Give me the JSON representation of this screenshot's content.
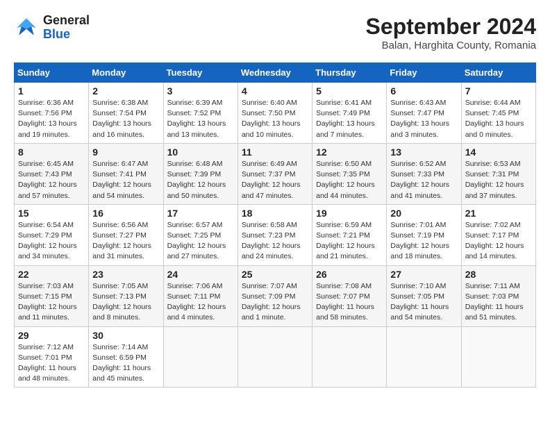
{
  "header": {
    "logo_line1": "General",
    "logo_line2": "Blue",
    "month": "September 2024",
    "location": "Balan, Harghita County, Romania"
  },
  "weekdays": [
    "Sunday",
    "Monday",
    "Tuesday",
    "Wednesday",
    "Thursday",
    "Friday",
    "Saturday"
  ],
  "weeks": [
    [
      {
        "day": "1",
        "sunrise": "6:36 AM",
        "sunset": "7:56 PM",
        "daylight": "13 hours and 19 minutes."
      },
      {
        "day": "2",
        "sunrise": "6:38 AM",
        "sunset": "7:54 PM",
        "daylight": "13 hours and 16 minutes."
      },
      {
        "day": "3",
        "sunrise": "6:39 AM",
        "sunset": "7:52 PM",
        "daylight": "13 hours and 13 minutes."
      },
      {
        "day": "4",
        "sunrise": "6:40 AM",
        "sunset": "7:50 PM",
        "daylight": "13 hours and 10 minutes."
      },
      {
        "day": "5",
        "sunrise": "6:41 AM",
        "sunset": "7:49 PM",
        "daylight": "13 hours and 7 minutes."
      },
      {
        "day": "6",
        "sunrise": "6:43 AM",
        "sunset": "7:47 PM",
        "daylight": "13 hours and 3 minutes."
      },
      {
        "day": "7",
        "sunrise": "6:44 AM",
        "sunset": "7:45 PM",
        "daylight": "13 hours and 0 minutes."
      }
    ],
    [
      {
        "day": "8",
        "sunrise": "6:45 AM",
        "sunset": "7:43 PM",
        "daylight": "12 hours and 57 minutes."
      },
      {
        "day": "9",
        "sunrise": "6:47 AM",
        "sunset": "7:41 PM",
        "daylight": "12 hours and 54 minutes."
      },
      {
        "day": "10",
        "sunrise": "6:48 AM",
        "sunset": "7:39 PM",
        "daylight": "12 hours and 50 minutes."
      },
      {
        "day": "11",
        "sunrise": "6:49 AM",
        "sunset": "7:37 PM",
        "daylight": "12 hours and 47 minutes."
      },
      {
        "day": "12",
        "sunrise": "6:50 AM",
        "sunset": "7:35 PM",
        "daylight": "12 hours and 44 minutes."
      },
      {
        "day": "13",
        "sunrise": "6:52 AM",
        "sunset": "7:33 PM",
        "daylight": "12 hours and 41 minutes."
      },
      {
        "day": "14",
        "sunrise": "6:53 AM",
        "sunset": "7:31 PM",
        "daylight": "12 hours and 37 minutes."
      }
    ],
    [
      {
        "day": "15",
        "sunrise": "6:54 AM",
        "sunset": "7:29 PM",
        "daylight": "12 hours and 34 minutes."
      },
      {
        "day": "16",
        "sunrise": "6:56 AM",
        "sunset": "7:27 PM",
        "daylight": "12 hours and 31 minutes."
      },
      {
        "day": "17",
        "sunrise": "6:57 AM",
        "sunset": "7:25 PM",
        "daylight": "12 hours and 27 minutes."
      },
      {
        "day": "18",
        "sunrise": "6:58 AM",
        "sunset": "7:23 PM",
        "daylight": "12 hours and 24 minutes."
      },
      {
        "day": "19",
        "sunrise": "6:59 AM",
        "sunset": "7:21 PM",
        "daylight": "12 hours and 21 minutes."
      },
      {
        "day": "20",
        "sunrise": "7:01 AM",
        "sunset": "7:19 PM",
        "daylight": "12 hours and 18 minutes."
      },
      {
        "day": "21",
        "sunrise": "7:02 AM",
        "sunset": "7:17 PM",
        "daylight": "12 hours and 14 minutes."
      }
    ],
    [
      {
        "day": "22",
        "sunrise": "7:03 AM",
        "sunset": "7:15 PM",
        "daylight": "12 hours and 11 minutes."
      },
      {
        "day": "23",
        "sunrise": "7:05 AM",
        "sunset": "7:13 PM",
        "daylight": "12 hours and 8 minutes."
      },
      {
        "day": "24",
        "sunrise": "7:06 AM",
        "sunset": "7:11 PM",
        "daylight": "12 hours and 4 minutes."
      },
      {
        "day": "25",
        "sunrise": "7:07 AM",
        "sunset": "7:09 PM",
        "daylight": "12 hours and 1 minute."
      },
      {
        "day": "26",
        "sunrise": "7:08 AM",
        "sunset": "7:07 PM",
        "daylight": "11 hours and 58 minutes."
      },
      {
        "day": "27",
        "sunrise": "7:10 AM",
        "sunset": "7:05 PM",
        "daylight": "11 hours and 54 minutes."
      },
      {
        "day": "28",
        "sunrise": "7:11 AM",
        "sunset": "7:03 PM",
        "daylight": "11 hours and 51 minutes."
      }
    ],
    [
      {
        "day": "29",
        "sunrise": "7:12 AM",
        "sunset": "7:01 PM",
        "daylight": "11 hours and 48 minutes."
      },
      {
        "day": "30",
        "sunrise": "7:14 AM",
        "sunset": "6:59 PM",
        "daylight": "11 hours and 45 minutes."
      },
      null,
      null,
      null,
      null,
      null
    ]
  ]
}
